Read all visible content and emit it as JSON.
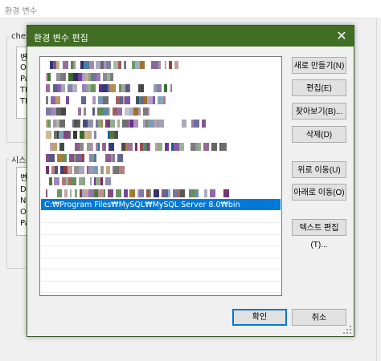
{
  "parent": {
    "title": "환경 변수",
    "user_group_label": "chez",
    "user_list_header": "변",
    "user_list_rows": [
      "OI",
      "Pa",
      "TE",
      "TM"
    ],
    "system_group_label": "시스",
    "system_list_header": "변",
    "system_list_rows": [
      "Dr",
      "NU",
      "OS",
      "Pa"
    ]
  },
  "dialog": {
    "title": "환경 변수 편집",
    "close_icon": "✕",
    "paths": [
      {
        "text": "",
        "obscured": true
      },
      {
        "text": "",
        "obscured": true
      },
      {
        "text": "",
        "obscured": true
      },
      {
        "text": "",
        "obscured": true
      },
      {
        "text": "",
        "obscured": true
      },
      {
        "text": "",
        "obscured": true
      },
      {
        "text": "",
        "obscured": true
      },
      {
        "text": "",
        "obscured": true
      },
      {
        "text": "",
        "obscured": true
      },
      {
        "text": "",
        "obscured": true
      },
      {
        "text": "",
        "obscured": true
      },
      {
        "text": "",
        "obscured": true
      },
      {
        "text": "C:₩Program Files₩MySQL₩MySQL Server 8.0₩bin",
        "obscured": false,
        "selected": true
      }
    ],
    "buttons": {
      "new": "새로 만들기(N)",
      "edit": "편집(E)",
      "browse": "찾아보기(B)...",
      "delete": "삭제(D)",
      "move_up": "위로 이동(U)",
      "move_down": "아래로 이동(O)",
      "edit_text": "텍스트 편집(T)...",
      "ok": "확인",
      "cancel": "취소"
    }
  },
  "colors": {
    "titlebar": "#406e22",
    "selection": "#0078d7",
    "default_button_border": "#0078d7"
  }
}
